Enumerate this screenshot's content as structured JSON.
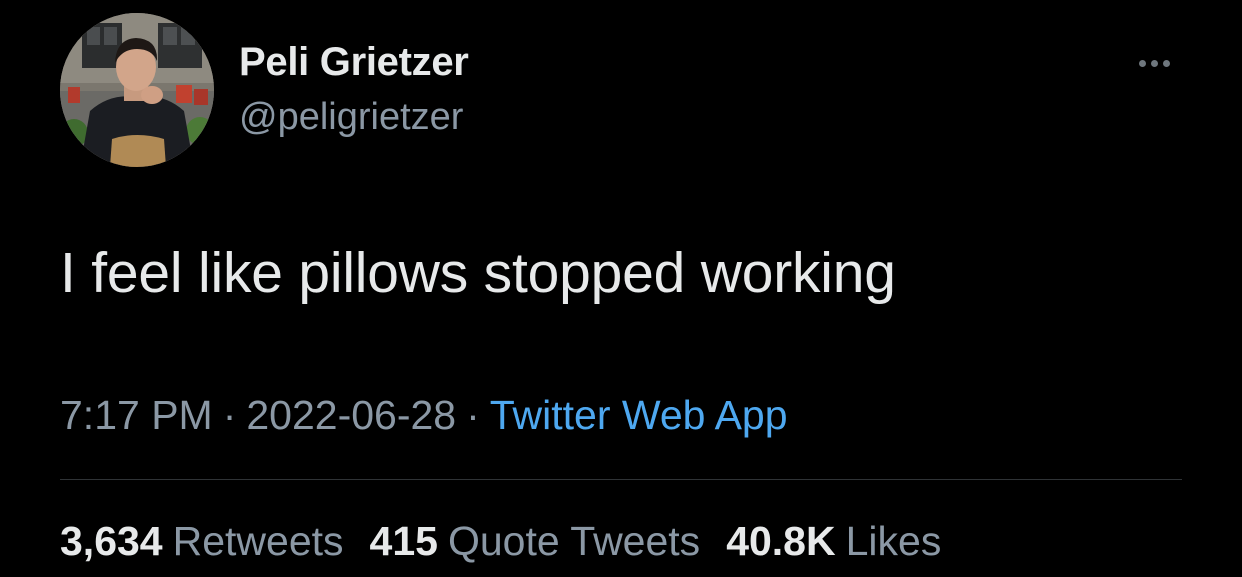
{
  "colors": {
    "background": "#000000",
    "primary_text": "#e7e9ea",
    "secondary_text": "#8b98a5",
    "link": "#4ea8f0",
    "divider": "#2f3336"
  },
  "author": {
    "avatar_icon": "profile-photo",
    "display_name": "Peli Grietzer",
    "handle": "@peligrietzer"
  },
  "more_icon": "more-horizontal-icon",
  "tweet": {
    "text": "I feel like pillows stopped working"
  },
  "meta": {
    "time": "7:17 PM",
    "separator": "·",
    "date": "2022-06-28",
    "source": "Twitter Web App"
  },
  "stats": {
    "retweets": {
      "count": "3,634",
      "label": "Retweets"
    },
    "quotes": {
      "count": "415",
      "label": "Quote Tweets"
    },
    "likes": {
      "count": "40.8K",
      "label": "Likes"
    }
  }
}
